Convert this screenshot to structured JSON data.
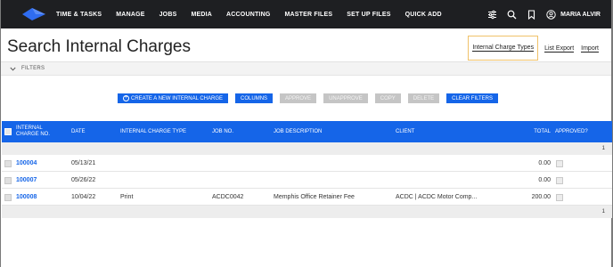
{
  "nav": {
    "items": [
      "TIME & TASKS",
      "MANAGE",
      "JOBS",
      "MEDIA",
      "ACCOUNTING",
      "MASTER FILES",
      "SET UP FILES",
      "QUICK ADD"
    ],
    "user_name": "MARIA ALVIR",
    "icons": [
      "sliders-icon",
      "search-icon",
      "bookmark-icon",
      "user-icon"
    ]
  },
  "header": {
    "title": "Search Internal Charges",
    "links": [
      "Internal Charge Types",
      "List Export",
      "Import"
    ]
  },
  "filters": {
    "label": "FILTERS"
  },
  "actions": [
    {
      "label": "CREATE A NEW INTERNAL CHARGE",
      "enabled": true
    },
    {
      "label": "COLUMNS",
      "enabled": true
    },
    {
      "label": "APPROVE",
      "enabled": false
    },
    {
      "label": "UNAPPROVE",
      "enabled": false
    },
    {
      "label": "COPY",
      "enabled": false
    },
    {
      "label": "DELETE",
      "enabled": false
    },
    {
      "label": "CLEAR FILTERS",
      "enabled": true
    }
  ],
  "table": {
    "columns": {
      "charge_no": "INTERNAL\nCHARGE NO.",
      "date": "DATE",
      "type": "INTERNAL CHARGE TYPE",
      "job_no": "JOB NO.",
      "job_desc": "JOB DESCRIPTION",
      "client": "CLIENT",
      "total": "TOTAL",
      "approved": "APPROVED?"
    },
    "page_top": "1",
    "page_bottom": "1",
    "rows": [
      {
        "charge_no": "100004",
        "date": "05/13/21",
        "type": "",
        "job_no": "",
        "job_desc": "",
        "client": "",
        "total": "0.00"
      },
      {
        "charge_no": "100007",
        "date": "05/26/22",
        "type": "",
        "job_no": "",
        "job_desc": "",
        "client": "",
        "total": "0.00"
      },
      {
        "charge_no": "100008",
        "date": "10/04/22",
        "type": "Print",
        "job_no": "ACDC0042",
        "job_desc": "Memphis Office Retainer Fee",
        "client": "ACDC | ACDC Motor Comp...",
        "total": "200.00"
      }
    ]
  },
  "colors": {
    "nav_bg": "#1e1f22",
    "accent": "#1565e8",
    "logo": "#2f6cf0",
    "disabled": "#c5c5c5"
  }
}
